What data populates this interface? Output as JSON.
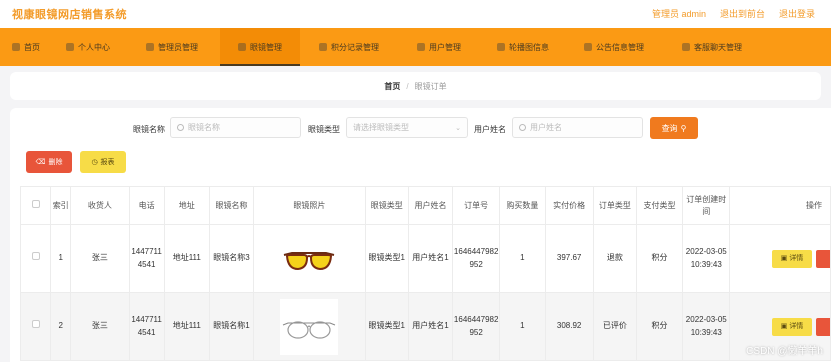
{
  "brand": "视康眼镜网店销售系统",
  "toplinks": {
    "user": "管理员 admin",
    "front": "退出到前台",
    "logout": "退出登录"
  },
  "nav": [
    {
      "label": "首页"
    },
    {
      "label": "个人中心"
    },
    {
      "label": "管理员管理"
    },
    {
      "label": "眼镜管理"
    },
    {
      "label": "积分记录管理"
    },
    {
      "label": "用户管理"
    },
    {
      "label": "轮播图信息"
    },
    {
      "label": "公告信息管理"
    },
    {
      "label": "客服聊天管理"
    }
  ],
  "breadcrumb": {
    "home": "首页",
    "sep": "/",
    "current": "眼镜订单"
  },
  "filters": {
    "name_label": "眼镜名称",
    "name_placeholder": "眼镜名称",
    "type_label": "眼镜类型",
    "type_placeholder": "请选择眼镜类型",
    "user_label": "用户姓名",
    "user_placeholder": "用户姓名",
    "search_label": "查询"
  },
  "actions": {
    "delete": "删除",
    "report": "报表"
  },
  "table": {
    "headers": [
      "",
      "索引",
      "收货人",
      "电话",
      "地址",
      "眼镜名称",
      "眼镜照片",
      "眼镜类型",
      "用户姓名",
      "订单号",
      "购买数量",
      "实付价格",
      "订单类型",
      "支付类型",
      "订单创建时间",
      "操作"
    ],
    "detail_label": "详情",
    "rows": [
      {
        "index": "1",
        "receiver": "张三",
        "phone": "14477114541",
        "address": "地址111",
        "glasses_name": "眼镜名称3",
        "glasses_type": "眼镜类型1",
        "user_name": "用户姓名1",
        "order_no": "1646447982952",
        "quantity": "1",
        "price": "397.67",
        "order_type": "退款",
        "pay_type": "积分",
        "created": "2022-03-05 10:39:43"
      },
      {
        "index": "2",
        "receiver": "张三",
        "phone": "14477114541",
        "address": "地址111",
        "glasses_name": "眼镜名称1",
        "glasses_type": "眼镜类型1",
        "user_name": "用户姓名1",
        "order_no": "1646447982952",
        "quantity": "1",
        "price": "308.92",
        "order_type": "已评价",
        "pay_type": "积分",
        "created": "2022-03-05 10:39:43"
      }
    ]
  },
  "watermark": "CSDN @懒羊羊h",
  "colors": {
    "accent": "#fb9a14",
    "brand_text": "#f39c2b",
    "search_btn": "#f07a1e",
    "danger": "#e8553a",
    "warn": "#f7dc47"
  }
}
